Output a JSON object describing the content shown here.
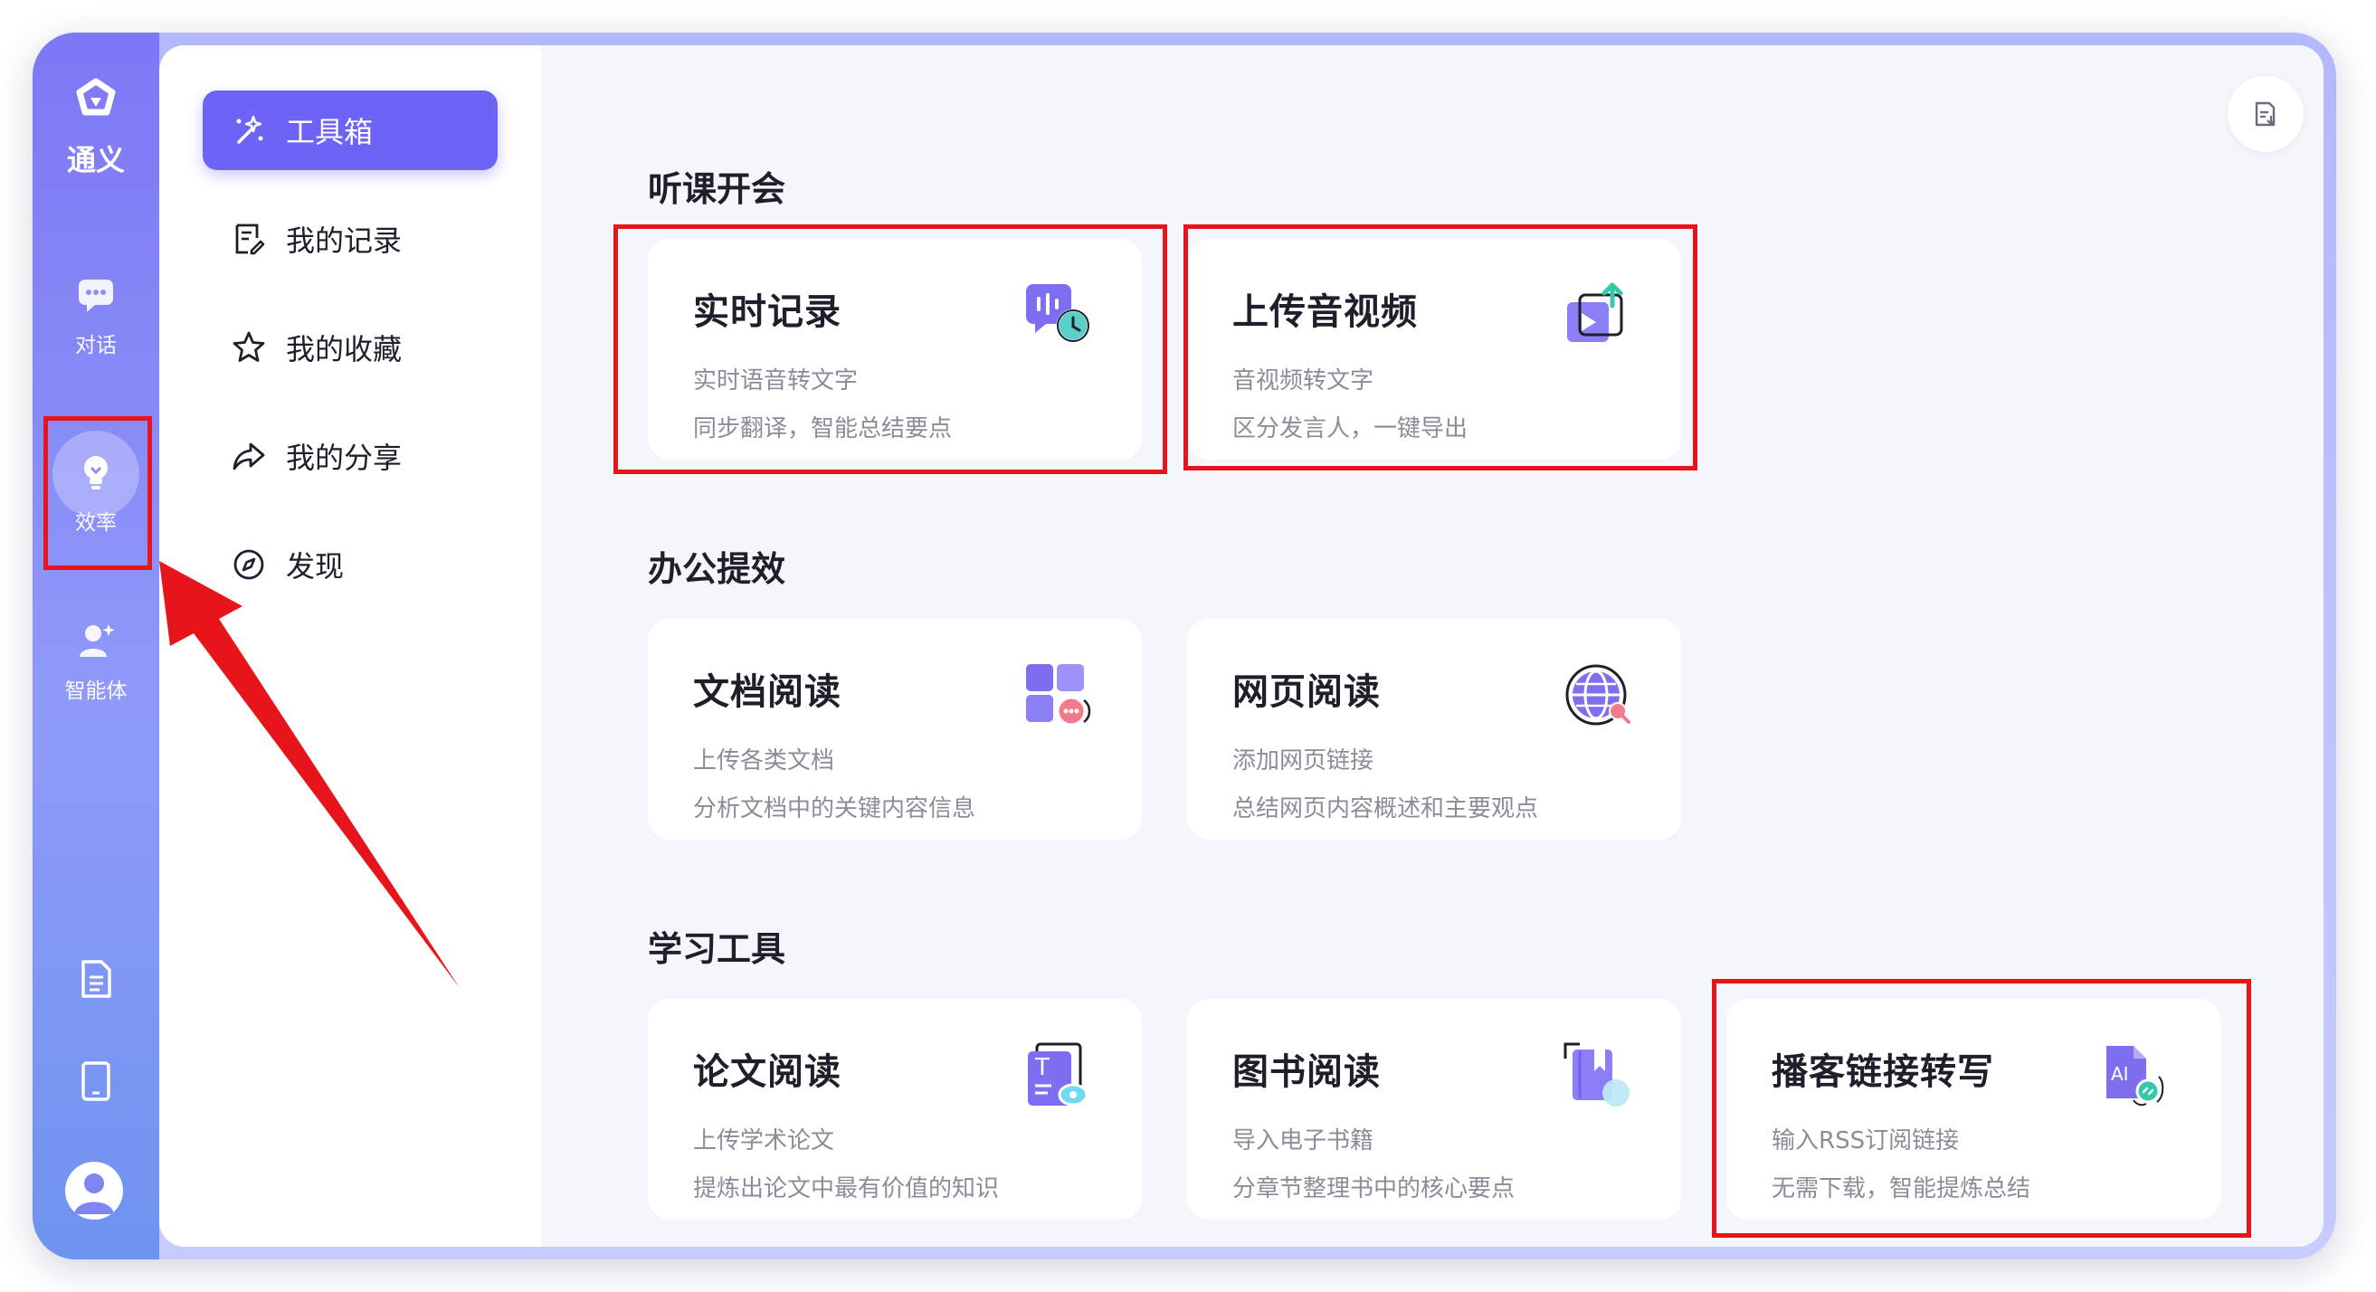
{
  "app": {
    "logo_text": "通义",
    "rail": {
      "chat_label": "对话",
      "efficiency_label": "效率",
      "agent_label": "智能体"
    }
  },
  "sidebar": {
    "items": [
      {
        "label": "工具箱"
      },
      {
        "label": "我的记录"
      },
      {
        "label": "我的收藏"
      },
      {
        "label": "我的分享"
      },
      {
        "label": "发现"
      }
    ]
  },
  "sections": [
    {
      "title": "听课开会",
      "cards": [
        {
          "title": "实时记录",
          "desc1": "实时语音转文字",
          "desc2": "同步翻译，智能总结要点"
        },
        {
          "title": "上传音视频",
          "desc1": "音视频转文字",
          "desc2": "区分发言人，一键导出"
        }
      ]
    },
    {
      "title": "办公提效",
      "cards": [
        {
          "title": "文档阅读",
          "desc1": "上传各类文档",
          "desc2": "分析文档中的关键内容信息"
        },
        {
          "title": "网页阅读",
          "desc1": "添加网页链接",
          "desc2": "总结网页内容概述和主要观点"
        }
      ]
    },
    {
      "title": "学习工具",
      "cards": [
        {
          "title": "论文阅读",
          "desc1": "上传学术论文",
          "desc2": "提炼出论文中最有价值的知识"
        },
        {
          "title": "图书阅读",
          "desc1": "导入电子书籍",
          "desc2": "分章节整理书中的核心要点"
        },
        {
          "title": "播客链接转写",
          "desc1": "输入RSS订阅链接",
          "desc2": "无需下载，智能提炼总结"
        }
      ]
    }
  ],
  "colors": {
    "accent": "#6d63f5",
    "highlight": "#e8141b"
  }
}
